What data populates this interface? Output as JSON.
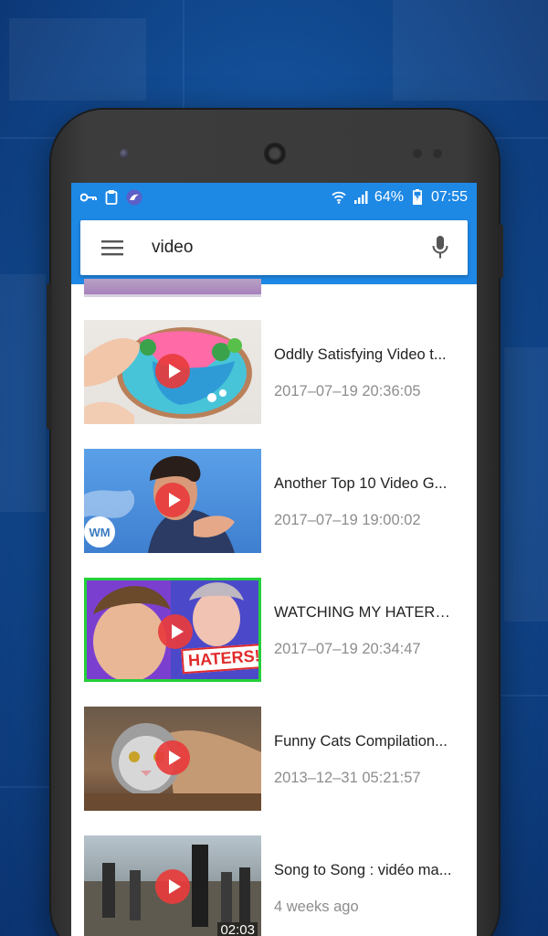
{
  "status_bar": {
    "icons_left": [
      "key-icon",
      "clipboard-icon",
      "app-badge-icon"
    ],
    "battery": "64%",
    "time": "07:55",
    "icons_right": [
      "wifi-icon",
      "signal-icon",
      "battery-charging-icon"
    ]
  },
  "search": {
    "query": "video",
    "menu_icon": "hamburger-menu-icon",
    "mic_icon": "microphone-icon"
  },
  "results": [
    {
      "title": "Oddly Satisfying Video t...",
      "date": "2017–07–19 20:36:05",
      "duration": ""
    },
    {
      "title": "Another Top 10 Video G...",
      "date": "2017–07–19 19:00:02",
      "duration": "",
      "badge": "WM"
    },
    {
      "title": "WATCHING MY HATERS...",
      "date": "2017–07–19 20:34:47",
      "duration": "",
      "thumb_text": "HATERS!"
    },
    {
      "title": "Funny Cats Compilation...",
      "date": "2013–12–31 05:21:57",
      "duration": ""
    },
    {
      "title": "Song to Song : vidéo ma...",
      "date": "4 weeks ago",
      "duration": "02:03"
    }
  ],
  "colors": {
    "accent": "#1e88e5",
    "play_button": "#e83c3c",
    "date_text": "#8d8d8d"
  }
}
